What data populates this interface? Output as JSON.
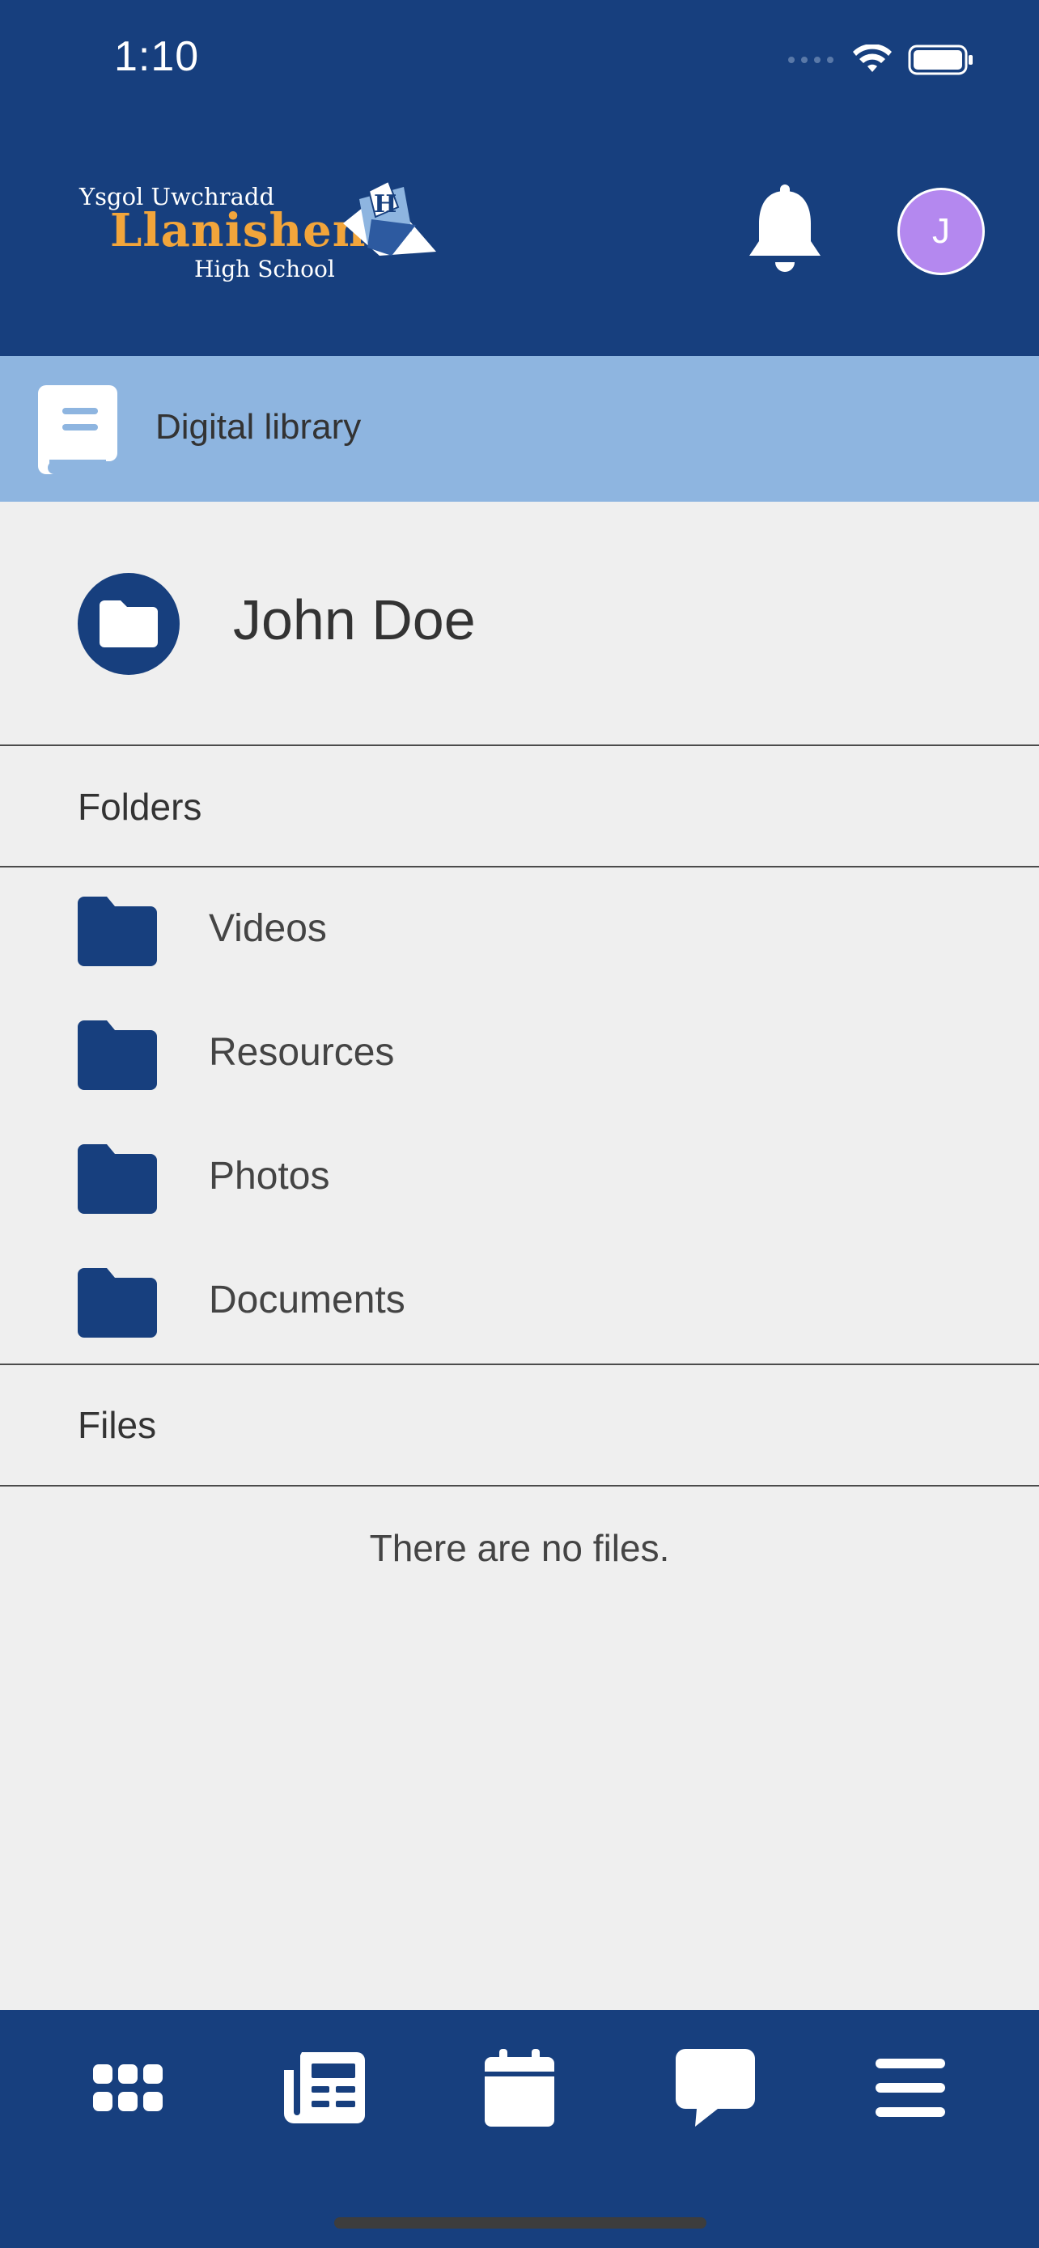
{
  "status_bar": {
    "time": "1:10"
  },
  "header": {
    "logo": {
      "line1": "Ysgol Uwchradd",
      "line2": "Llanishen",
      "line3": "High School",
      "badge_letter": "H"
    },
    "avatar_initial": "J",
    "bell_icon": "bell-icon"
  },
  "subheader": {
    "title": "Digital library",
    "icon": "book-icon"
  },
  "owner": {
    "name": "John Doe",
    "icon": "folder-icon"
  },
  "folders_section": {
    "heading": "Folders",
    "items": [
      {
        "label": "Videos"
      },
      {
        "label": "Resources"
      },
      {
        "label": "Photos"
      },
      {
        "label": "Documents"
      }
    ]
  },
  "files_section": {
    "heading": "Files",
    "empty_message": "There are no files."
  },
  "tab_bar": {
    "tabs": [
      {
        "icon": "apps-grid-icon"
      },
      {
        "icon": "newspaper-icon"
      },
      {
        "icon": "calendar-icon"
      },
      {
        "icon": "chat-bubble-icon"
      },
      {
        "icon": "menu-icon"
      }
    ]
  },
  "colors": {
    "primary": "#173f7e",
    "subheader": "#8eb5e0",
    "background": "#efefef",
    "avatar": "#b488ef",
    "logo_accent": "#f2a53b"
  }
}
